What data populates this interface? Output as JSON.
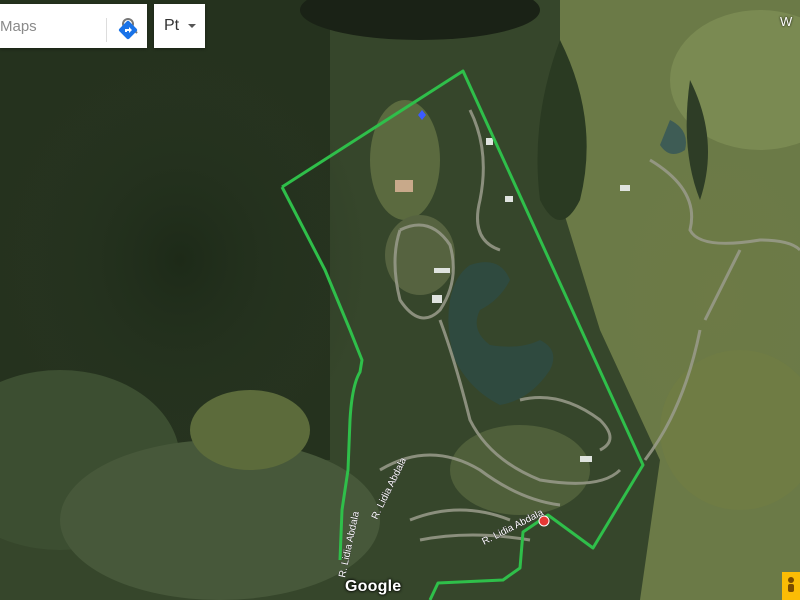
{
  "search": {
    "placeholder": "Maps"
  },
  "language": {
    "label": "Pt"
  },
  "compass": {
    "label": "W"
  },
  "logo": {
    "text": "Google"
  },
  "roads": [
    {
      "label": "R. Lidia Abdala"
    },
    {
      "label": "R. Lidia Abdala"
    },
    {
      "label": "R. Lidia Abdala"
    }
  ],
  "boundary": {
    "color": "#2fbf4a"
  },
  "markers": {
    "start_color": "#e53935",
    "end_color": "#3b5bff"
  }
}
